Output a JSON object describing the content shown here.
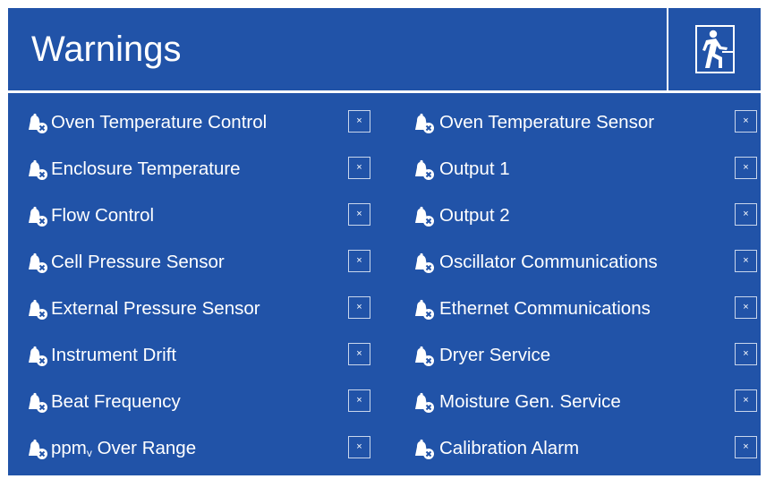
{
  "header": {
    "title": "Warnings",
    "exit_icon": "emergency-exit-icon"
  },
  "dismiss_glyph": "×",
  "left_warnings": [
    {
      "label": "Oven Temperature Control"
    },
    {
      "label": "Enclosure Temperature"
    },
    {
      "label": "Flow Control"
    },
    {
      "label": "Cell Pressure Sensor"
    },
    {
      "label": "External Pressure Sensor"
    },
    {
      "label": "Instrument Drift"
    },
    {
      "label": "Beat Frequency"
    },
    {
      "label_main": "ppm",
      "label_sub": "v",
      "label_rest": " Over Range"
    }
  ],
  "right_warnings": [
    {
      "label": "Oven Temperature Sensor"
    },
    {
      "label": "Output 1"
    },
    {
      "label": "Output 2"
    },
    {
      "label": "Oscillator Communications"
    },
    {
      "label": "Ethernet Communications"
    },
    {
      "label": "Dryer Service"
    },
    {
      "label": "Moisture Gen. Service"
    },
    {
      "label": "Calibration Alarm"
    }
  ],
  "row_icon": "warning-bell-icon",
  "colors": {
    "background": "#2153a8",
    "text": "#ffffff",
    "box_border": "#c9d6ec"
  }
}
